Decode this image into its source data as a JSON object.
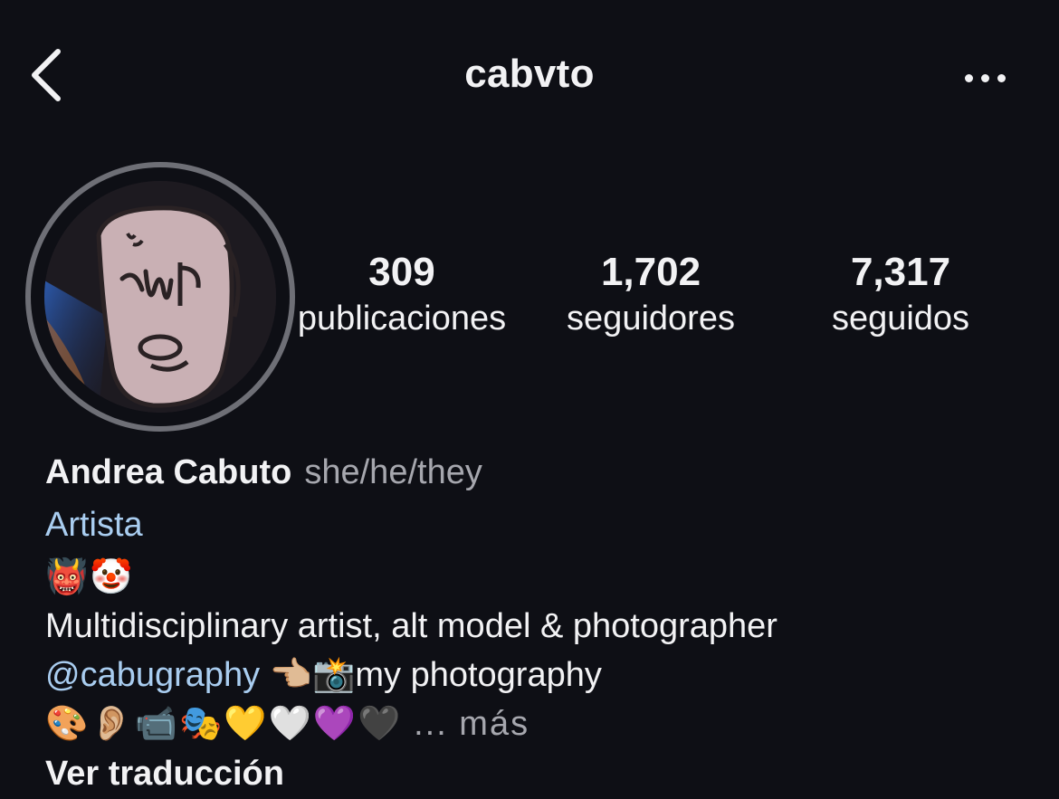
{
  "header": {
    "username": "cabvto"
  },
  "icons": {
    "back": "chevron-left-icon",
    "more": "more-horizontal-icon"
  },
  "stats": {
    "posts": {
      "count": "309",
      "label": "publicaciones"
    },
    "followers": {
      "count": "1,702",
      "label": "seguidores"
    },
    "following": {
      "count": "7,317",
      "label": "seguidos"
    }
  },
  "profile": {
    "display_name": "Andrea Cabuto",
    "pronouns": "she/he/they",
    "category": "Artista",
    "emoji_line": "👹🤡",
    "bio_line_1": "Multidisciplinary artist, alt model & photographer",
    "mention": "@cabugraphy",
    "bio_line_2_rest": " 👈🏼📸my photography",
    "emoji_line_2": "🎨👂🏼📹🎭💛🤍💜🖤",
    "more_ellipsis": "... más",
    "translate_label": "Ver traducción"
  },
  "colors": {
    "background": "#0e0f15",
    "text": "#f2f2f4",
    "secondary_text": "#a6a7ae",
    "link": "#a9cdf0",
    "avatar_ring": "#6e6f76"
  }
}
